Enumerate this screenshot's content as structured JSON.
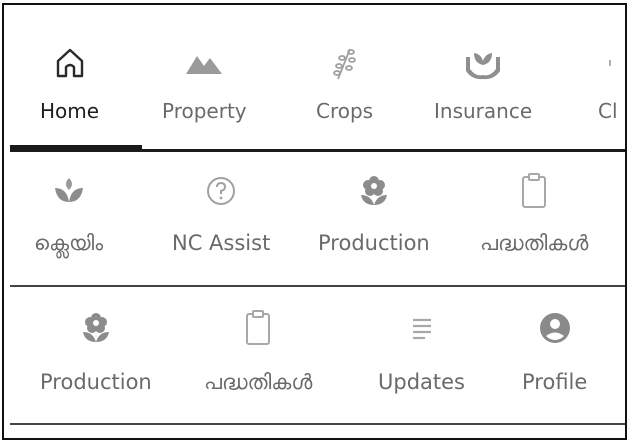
{
  "nav_top": {
    "items": [
      {
        "label": "Home",
        "icon": "home-icon",
        "active": true
      },
      {
        "label": "Property",
        "icon": "mountains-icon"
      },
      {
        "label": "Crops",
        "icon": "crop-plant-icon"
      },
      {
        "label": "Insurance",
        "icon": "insurance-hands-plant-icon"
      },
      {
        "label": "Cl",
        "icon": "claim-icon"
      }
    ]
  },
  "nav_middle": {
    "items": [
      {
        "label": "ക്ലെയിം",
        "icon": "sprout-icon"
      },
      {
        "label": "NC Assist",
        "icon": "help-circle-icon"
      },
      {
        "label": "Production",
        "icon": "flower-icon"
      },
      {
        "label": "പദ്ധതികൾ",
        "icon": "clipboard-icon"
      }
    ]
  },
  "nav_bottom": {
    "items": [
      {
        "label": "Production",
        "icon": "flower-icon"
      },
      {
        "label": "പദ്ധതികൾ",
        "icon": "clipboard-icon"
      },
      {
        "label": "Updates",
        "icon": "list-lines-icon"
      },
      {
        "label": "Profile",
        "icon": "account-circle-icon"
      }
    ]
  },
  "colors": {
    "icon_gray": "#8a8a8a",
    "icon_light_gray": "#b5b5b5",
    "active_text": "#1e1e1e",
    "divider": "#1b1b1b"
  }
}
